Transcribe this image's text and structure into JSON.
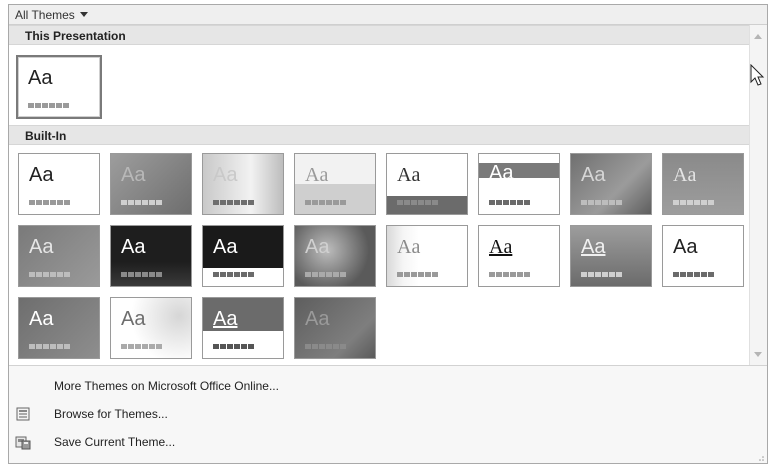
{
  "header": {
    "dropdown_label": "All Themes"
  },
  "sections": {
    "this_presentation": "This Presentation",
    "built_in": "Built-In"
  },
  "tile_text": "Aa",
  "menu": {
    "more_themes": "More Themes on Microsoft Office Online...",
    "browse": "Browse for Themes...",
    "save": "Save Current Theme..."
  },
  "icons": {
    "dropdown": "triangle-down-icon",
    "scroll_up": "arrow-up-icon",
    "scroll_down": "arrow-down-icon",
    "browse": "folder-browse-icon",
    "save": "save-theme-icon",
    "cursor": "mouse-pointer-icon",
    "grip": "resize-grip-icon"
  }
}
